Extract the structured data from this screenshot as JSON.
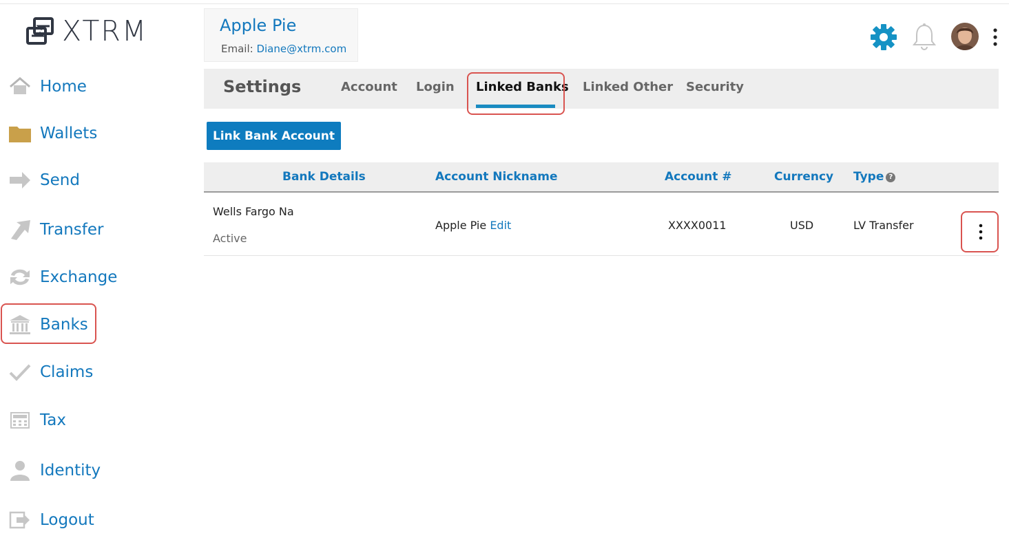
{
  "app": {
    "brand": "XTRM",
    "accent": "#1378bd",
    "highlight": "#d9534f"
  },
  "sidebar": {
    "items": [
      {
        "label": "Home",
        "icon": "home-icon"
      },
      {
        "label": "Wallets",
        "icon": "folder-icon"
      },
      {
        "label": "Send",
        "icon": "arrow-right-icon"
      },
      {
        "label": "Transfer",
        "icon": "transfer-arrow-icon"
      },
      {
        "label": "Exchange",
        "icon": "exchange-icon"
      },
      {
        "label": "Banks",
        "icon": "bank-icon"
      },
      {
        "label": "Claims",
        "icon": "checkmark-icon"
      },
      {
        "label": "Tax",
        "icon": "calculator-icon"
      },
      {
        "label": "Identity",
        "icon": "person-icon"
      },
      {
        "label": "Logout",
        "icon": "logout-icon"
      }
    ],
    "active": "Banks"
  },
  "profile": {
    "name": "Apple Pie",
    "email_label": "Email:",
    "email": "Diane@xtrm.com"
  },
  "header_icons": [
    "gear-icon",
    "bell-icon",
    "avatar",
    "more-vertical-icon"
  ],
  "settings": {
    "title": "Settings",
    "tabs": [
      {
        "label": "Account"
      },
      {
        "label": "Login"
      },
      {
        "label": "Linked Banks",
        "active": true
      },
      {
        "label": "Linked Other"
      },
      {
        "label": "Security"
      }
    ]
  },
  "actions": {
    "link_bank": "Link Bank Account"
  },
  "table": {
    "headers": {
      "bank_details": "Bank Details",
      "nickname": "Account Nickname",
      "account": "Account #",
      "currency": "Currency",
      "type": "Type"
    },
    "rows": [
      {
        "bank": "Wells Fargo Na",
        "status": "Active",
        "nickname": "Apple Pie",
        "edit": "Edit",
        "account": "XXXX0011",
        "currency": "USD",
        "type": "LV Transfer"
      }
    ]
  }
}
